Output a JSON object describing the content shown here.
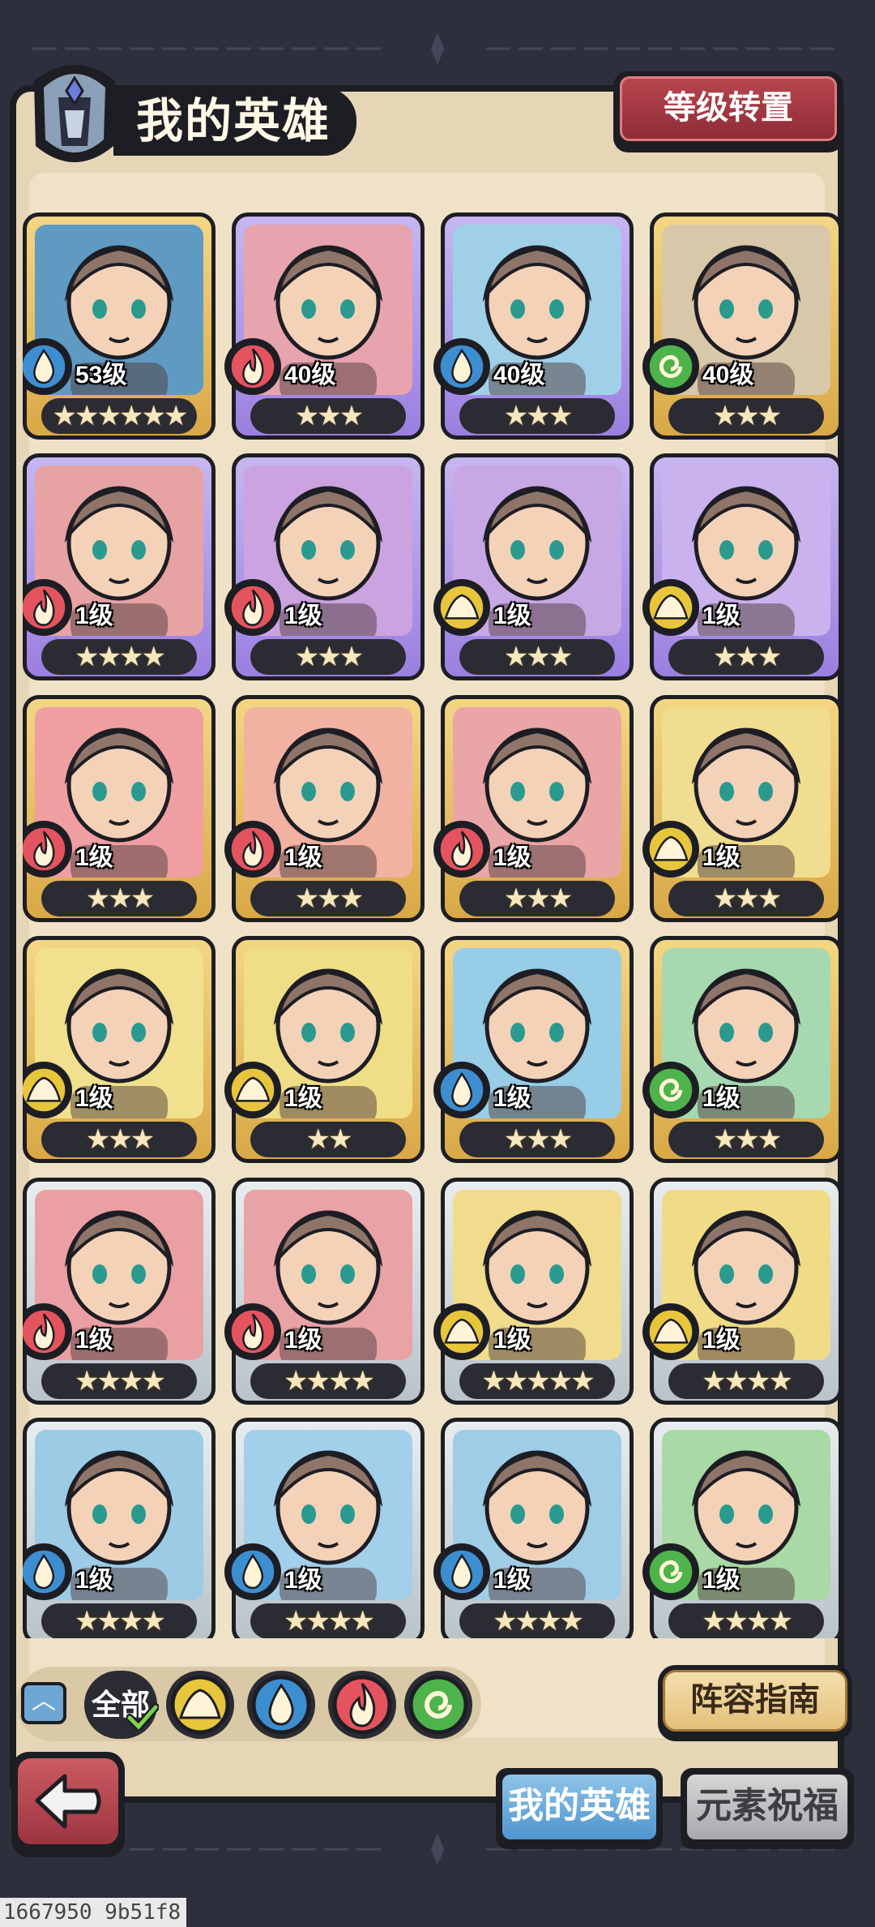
{
  "header": {
    "title": "我的英雄",
    "level_transfer_label": "等级转置"
  },
  "colors": {
    "fire": "#e4545e",
    "water": "#3d8ed0",
    "earth": "#e8c63b",
    "wind": "#4db34a",
    "panel": "#efe2c6",
    "dark": "#1d1d24"
  },
  "heroes": [
    {
      "level": "53级",
      "stars": "★★★★★★",
      "element": "water",
      "rarity": "gold",
      "portrait": "#5f9ac2"
    },
    {
      "level": "40级",
      "stars": "★★★",
      "element": "fire",
      "rarity": "purple",
      "portrait": "#e7a3ae"
    },
    {
      "level": "40级",
      "stars": "★★★",
      "element": "water",
      "rarity": "purple",
      "portrait": "#9fd0e8"
    },
    {
      "level": "40级",
      "stars": "★★★",
      "element": "wind",
      "rarity": "gold",
      "portrait": "#d8c7a8"
    },
    {
      "level": "1级",
      "stars": "★★★★",
      "element": "fire",
      "rarity": "purple",
      "portrait": "#e7a3a3"
    },
    {
      "level": "1级",
      "stars": "★★★",
      "element": "fire",
      "rarity": "purple",
      "portrait": "#caa3e0"
    },
    {
      "level": "1级",
      "stars": "★★★",
      "element": "earth",
      "rarity": "purple",
      "portrait": "#c8a7e5"
    },
    {
      "level": "1级",
      "stars": "★★★",
      "element": "earth",
      "rarity": "purple",
      "portrait": "#c9b2ee"
    },
    {
      "level": "1级",
      "stars": "★★★",
      "element": "fire",
      "rarity": "gold",
      "portrait": "#ef9ea1"
    },
    {
      "level": "1级",
      "stars": "★★★",
      "element": "fire",
      "rarity": "gold",
      "portrait": "#f1b2a2"
    },
    {
      "level": "1级",
      "stars": "★★★",
      "element": "fire",
      "rarity": "gold",
      "portrait": "#eaa6a6"
    },
    {
      "level": "1级",
      "stars": "★★★",
      "element": "earth",
      "rarity": "gold",
      "portrait": "#f1dd8f"
    },
    {
      "level": "1级",
      "stars": "★★★",
      "element": "earth",
      "rarity": "gold",
      "portrait": "#f1e08d"
    },
    {
      "level": "1级",
      "stars": "★★",
      "element": "earth",
      "rarity": "gold",
      "portrait": "#efde86"
    },
    {
      "level": "1级",
      "stars": "★★★",
      "element": "water",
      "rarity": "gold",
      "portrait": "#97cde7"
    },
    {
      "level": "1级",
      "stars": "★★★",
      "element": "wind",
      "rarity": "gold",
      "portrait": "#a7d9b0"
    },
    {
      "level": "1级",
      "stars": "★★★★",
      "element": "fire",
      "rarity": "silver",
      "portrait": "#eaa0a3"
    },
    {
      "level": "1级",
      "stars": "★★★★",
      "element": "fire",
      "rarity": "silver",
      "portrait": "#e9a2a5"
    },
    {
      "level": "1级",
      "stars": "★★★★★",
      "element": "earth",
      "rarity": "silver",
      "portrait": "#f0dc8c"
    },
    {
      "level": "1级",
      "stars": "★★★★",
      "element": "earth",
      "rarity": "silver",
      "portrait": "#f0db87"
    },
    {
      "level": "1级",
      "stars": "★★★★",
      "element": "water",
      "rarity": "silver",
      "portrait": "#9ccbe6"
    },
    {
      "level": "1级",
      "stars": "★★★★",
      "element": "water",
      "rarity": "silver",
      "portrait": "#a2cfe9"
    },
    {
      "level": "1级",
      "stars": "★★★★",
      "element": "water",
      "rarity": "silver",
      "portrait": "#a0cde6"
    },
    {
      "level": "1级",
      "stars": "★★★★",
      "element": "wind",
      "rarity": "silver",
      "portrait": "#a9d9a5"
    }
  ],
  "filters": {
    "all_label": "全部",
    "elements": [
      "earth",
      "water",
      "fire",
      "wind"
    ]
  },
  "lineup_guide_label": "阵容指南",
  "tabs": {
    "my_heroes": "我的英雄",
    "element_blessing": "元素祝福"
  },
  "footer_id": "1667950 9b51f8"
}
